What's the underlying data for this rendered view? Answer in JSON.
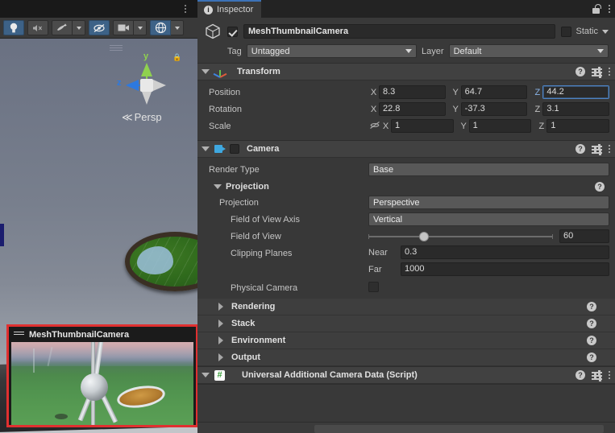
{
  "scene_view": {
    "toolbar": [
      {
        "name": "lighting-toggle",
        "icon": "lightbulb-icon",
        "active": true,
        "has_caret": false
      },
      {
        "name": "audio-toggle",
        "icon": "audio-mute-icon",
        "active": false,
        "has_caret": false
      },
      {
        "name": "effects-toggle",
        "icon": "fx-icon",
        "active": false,
        "has_caret": true
      },
      {
        "name": "hidden-objects-toggle",
        "icon": "eye-slash-icon",
        "active": true,
        "has_caret": false
      },
      {
        "name": "scene-camera-settings",
        "icon": "camera-icon",
        "active": false,
        "has_caret": true
      },
      {
        "name": "gizmos-toggle",
        "icon": "gizmo-globe-icon",
        "active": true,
        "has_caret": true
      }
    ],
    "gizmo": {
      "y_label": "y",
      "z_label": "z",
      "perspective_label": "Persp",
      "perspective_prefix": "≪"
    },
    "camera_preview": {
      "title": "MeshThumbnailCamera",
      "border_color": "#e03030"
    }
  },
  "inspector": {
    "tab_label": "Inspector",
    "tab_icon": "info-icon",
    "lock_icon": "lock-open-icon",
    "menu_icon": "kebab-menu-icon",
    "object": {
      "enabled": true,
      "name": "MeshThumbnailCamera",
      "static_label": "Static",
      "tag_label": "Tag",
      "tag_value": "Untagged",
      "layer_label": "Layer",
      "layer_value": "Default"
    },
    "transform": {
      "title": "Transform",
      "rows": [
        {
          "label": "Position",
          "x": "8.3",
          "y": "64.7",
          "z": "44.2",
          "z_focused": true,
          "has_lock": false
        },
        {
          "label": "Rotation",
          "x": "22.8",
          "y": "-37.3",
          "z": "3.1",
          "z_focused": false,
          "has_lock": false
        },
        {
          "label": "Scale",
          "x": "1",
          "y": "1",
          "z": "1",
          "z_focused": false,
          "has_lock": true
        }
      ],
      "axis_x": "X",
      "axis_y": "Y",
      "axis_z": "Z"
    },
    "camera": {
      "title": "Camera",
      "render_type_label": "Render Type",
      "render_type_value": "Base",
      "projection_group_label": "Projection",
      "projection_label": "Projection",
      "projection_value": "Perspective",
      "fov_axis_label": "Field of View Axis",
      "fov_axis_value": "Vertical",
      "fov_label": "Field of View",
      "fov_value": "60",
      "fov_slider_percent": 30,
      "clipping_label": "Clipping Planes",
      "near_label": "Near",
      "near_value": "0.3",
      "far_label": "Far",
      "far_value": "1000",
      "physical_camera_label": "Physical Camera",
      "physical_camera_checked": false,
      "sections": [
        {
          "label": "Rendering"
        },
        {
          "label": "Stack"
        },
        {
          "label": "Environment"
        },
        {
          "label": "Output"
        }
      ]
    },
    "script_component": {
      "title": "Universal Additional Camera Data (Script)",
      "icon": "script-hash-icon"
    }
  }
}
